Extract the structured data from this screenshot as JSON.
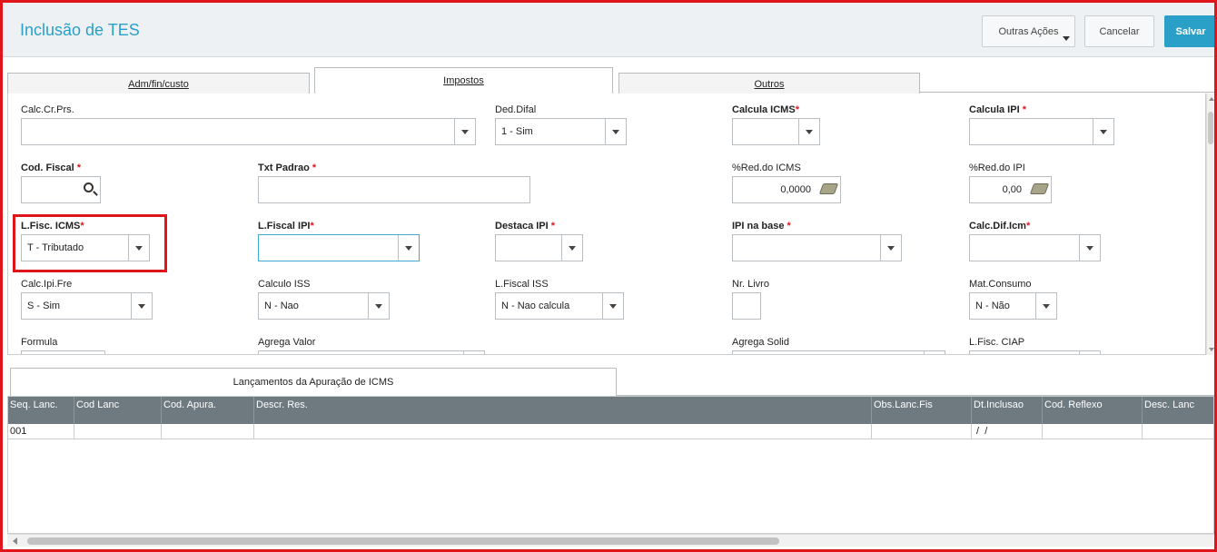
{
  "header": {
    "title": "Inclusão de TES",
    "more_actions": "Outras Ações",
    "cancel": "Cancelar",
    "save": "Salvar"
  },
  "tabs": [
    {
      "label": "Adm/fin/custo"
    },
    {
      "label": "Impostos"
    },
    {
      "label": "Outros"
    }
  ],
  "fields": {
    "calc_cr_prs": {
      "label": "Calc.Cr.Prs.",
      "value": ""
    },
    "ded_difal": {
      "label": "Ded.Difal",
      "value": "1 - Sim"
    },
    "calcula_icms": {
      "label": "Calcula ICMS",
      "value": ""
    },
    "calcula_ipi": {
      "label": "Calcula IPI",
      "value": ""
    },
    "cod_fiscal": {
      "label": "Cod. Fiscal",
      "value": ""
    },
    "txt_padrao": {
      "label": "Txt Padrao",
      "value": ""
    },
    "red_icms": {
      "label": "%Red.do ICMS",
      "value": "0,0000"
    },
    "red_ipi": {
      "label": "%Red.do IPI",
      "value": "0,00"
    },
    "lfisc_icms": {
      "label": "L.Fisc. ICMS",
      "value": "T - Tributado"
    },
    "lfiscal_ipi": {
      "label": "L.Fiscal IPI",
      "value": ""
    },
    "destaca_ipi": {
      "label": "Destaca IPI",
      "value": ""
    },
    "ipi_na_base": {
      "label": "IPI na base",
      "value": ""
    },
    "calc_dif_icm": {
      "label": "Calc.Dif.Icm",
      "value": ""
    },
    "calc_ipi_fre": {
      "label": "Calc.Ipi.Fre",
      "value": "S - Sim"
    },
    "calculo_iss": {
      "label": "Calculo ISS",
      "value": "N - Nao"
    },
    "lfiscal_iss": {
      "label": "L.Fiscal ISS",
      "value": "N - Nao calcula"
    },
    "nr_livro": {
      "label": "Nr. Livro",
      "value": ""
    },
    "mat_consumo": {
      "label": "Mat.Consumo",
      "value": "N - Não"
    },
    "formula": {
      "label": "Formula"
    },
    "agrega_valor": {
      "label": "Agrega Valor"
    },
    "agrega_solid": {
      "label": "Agrega Solid"
    },
    "lfisc_ciap": {
      "label": "L.Fisc. CIAP"
    }
  },
  "required_mark": "*",
  "lower_tab": {
    "label": "Lançamentos da Apuração de ICMS"
  },
  "grid": {
    "columns": [
      "Seq. Lanc.",
      "Cod Lanc",
      "Cod. Apura.",
      "Descr. Res.",
      "Obs.Lanc.Fis",
      "Dt.Inclusao",
      "Cod. Reflexo",
      "Desc. Lanc"
    ],
    "rows": [
      [
        "001",
        "",
        "",
        "",
        "",
        " /  /",
        "",
        ""
      ]
    ]
  },
  "colors": {
    "accent": "#2aa0c8",
    "highlight": "#e0151c",
    "grid_header": "#6e7a80"
  }
}
